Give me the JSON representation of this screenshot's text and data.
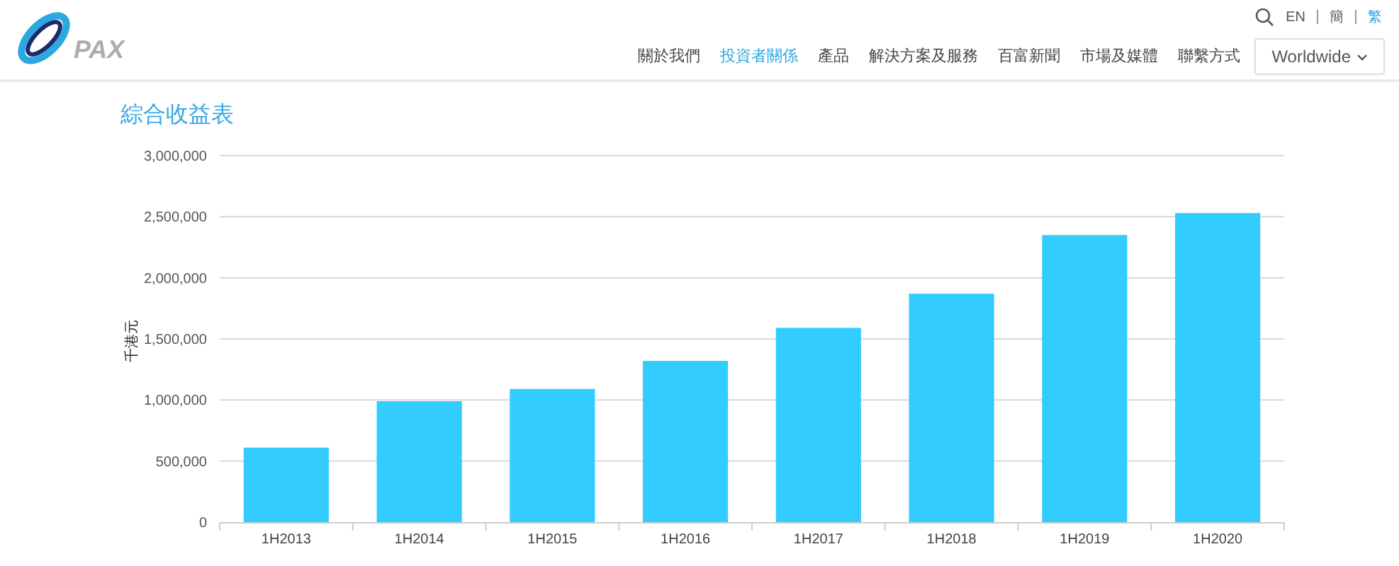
{
  "header": {
    "logo": "PAX",
    "languages": [
      {
        "label": "EN",
        "selected": false
      },
      {
        "label": "簡",
        "selected": false
      },
      {
        "label": "繁",
        "selected": true
      }
    ],
    "nav": [
      {
        "label": "關於我們",
        "selected": false
      },
      {
        "label": "投資者關係",
        "selected": true
      },
      {
        "label": "產品",
        "selected": false
      },
      {
        "label": "解決方案及服務",
        "selected": false
      },
      {
        "label": "百富新聞",
        "selected": false
      },
      {
        "label": "市場及媒體",
        "selected": false
      },
      {
        "label": "聯繫方式",
        "selected": false
      }
    ],
    "region_button": "Worldwide"
  },
  "section": {
    "title": "綜合收益表",
    "chart_data": {
      "type": "bar",
      "ylabel": "千港元",
      "categories": [
        "1H2013",
        "1H2014",
        "1H2015",
        "1H2016",
        "1H2017",
        "1H2018",
        "1H2019",
        "1H2020"
      ],
      "grid": true,
      "series": [
        {
          "color": "#33ccff",
          "values": [
            610000,
            990000,
            1090000,
            1320000,
            1590000,
            1870000,
            2350000,
            2530000
          ]
        }
      ],
      "ylim": [
        0,
        3000000
      ],
      "yticks": [
        {
          "value": 0,
          "label": "0"
        },
        {
          "value": 500000,
          "label": "500,000"
        },
        {
          "value": 1000000,
          "label": "1,000,000"
        },
        {
          "value": 1500000,
          "label": "1,500,000"
        },
        {
          "value": 2000000,
          "label": "2,000,000"
        },
        {
          "value": 2500000,
          "label": "2,500,000"
        },
        {
          "value": 3000000,
          "label": "3,000,000"
        }
      ]
    }
  }
}
